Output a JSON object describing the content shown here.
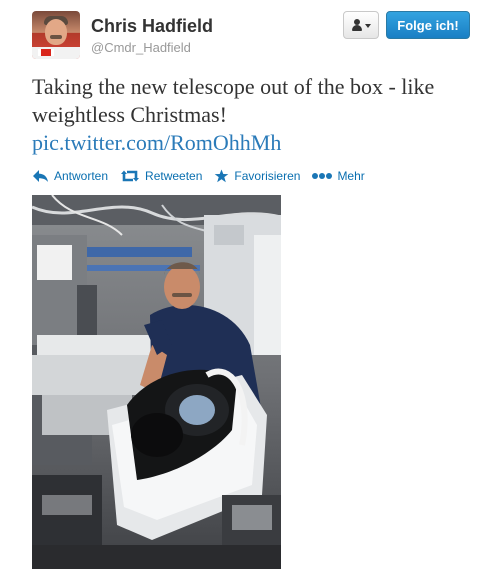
{
  "user": {
    "name": "Chris Hadfield",
    "handle": "@Cmdr_Hadfield"
  },
  "header": {
    "user_menu_icon": "user-dropdown-icon",
    "follow_label": "Folge ich!",
    "accent_color": "#2b7bb9"
  },
  "tweet": {
    "text": "Taking the new telescope out of the box - like weightless Christmas!",
    "link": "pic.twitter.com/RomOhhMh"
  },
  "actions": [
    {
      "icon": "reply-icon",
      "label": "Antworten"
    },
    {
      "icon": "retweet-icon",
      "label": "Retweeten"
    },
    {
      "icon": "star-icon",
      "label": "Favorisieren"
    },
    {
      "icon": "more-icon",
      "label": "Mehr"
    }
  ],
  "media": {
    "icon": "photo-astronaut-telescope"
  }
}
